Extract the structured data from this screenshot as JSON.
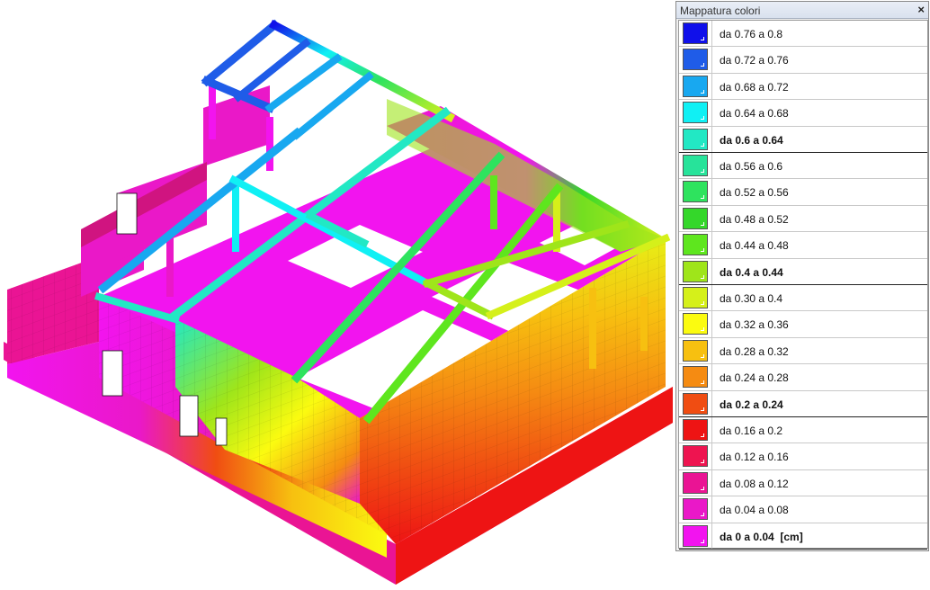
{
  "legend": {
    "title": "Mappatura colori",
    "close_label": "×",
    "items": [
      {
        "label": "da 0.76 a 0.8",
        "color": "#1010ea",
        "bold": false
      },
      {
        "label": "da 0.72 a 0.76",
        "color": "#1f5ce8",
        "bold": false
      },
      {
        "label": "da 0.68 a 0.72",
        "color": "#18a8f0",
        "bold": false
      },
      {
        "label": "da 0.64 a 0.68",
        "color": "#10f0f4",
        "bold": false
      },
      {
        "label": "da 0.6 a 0.64",
        "color": "#22e8c4",
        "bold": true
      },
      {
        "label": "da 0.56 a 0.6",
        "color": "#27e39a",
        "bold": false
      },
      {
        "label": "da 0.52 a 0.56",
        "color": "#2ee35e",
        "bold": false
      },
      {
        "label": "da 0.48 a 0.52",
        "color": "#34d72a",
        "bold": false
      },
      {
        "label": "da 0.44 a 0.48",
        "color": "#5ee61e",
        "bold": false
      },
      {
        "label": "da 0.4 a 0.44",
        "color": "#9fe51a",
        "bold": true
      },
      {
        "label": "da 0.30 a 0.4",
        "color": "#d5f01a",
        "bold": false
      },
      {
        "label": "da 0.32 a 0.36",
        "color": "#fbfb10",
        "bold": false
      },
      {
        "label": "da 0.28 a 0.32",
        "color": "#f7c010",
        "bold": false
      },
      {
        "label": "da 0.24 a 0.28",
        "color": "#f58b12",
        "bold": false
      },
      {
        "label": "da 0.2 a 0.24",
        "color": "#f04d12",
        "bold": true
      },
      {
        "label": "da 0.16 a 0.2",
        "color": "#ee1414",
        "bold": false
      },
      {
        "label": "da 0.12 a 0.16",
        "color": "#ee1450",
        "bold": false
      },
      {
        "label": "da 0.08 a 0.12",
        "color": "#ea1494",
        "bold": false
      },
      {
        "label": "da 0.04 a 0.08",
        "color": "#ea18c8",
        "bold": false
      },
      {
        "label": "da 0 a 0.04  [cm]",
        "color": "#f214ef",
        "bold": true
      }
    ]
  }
}
